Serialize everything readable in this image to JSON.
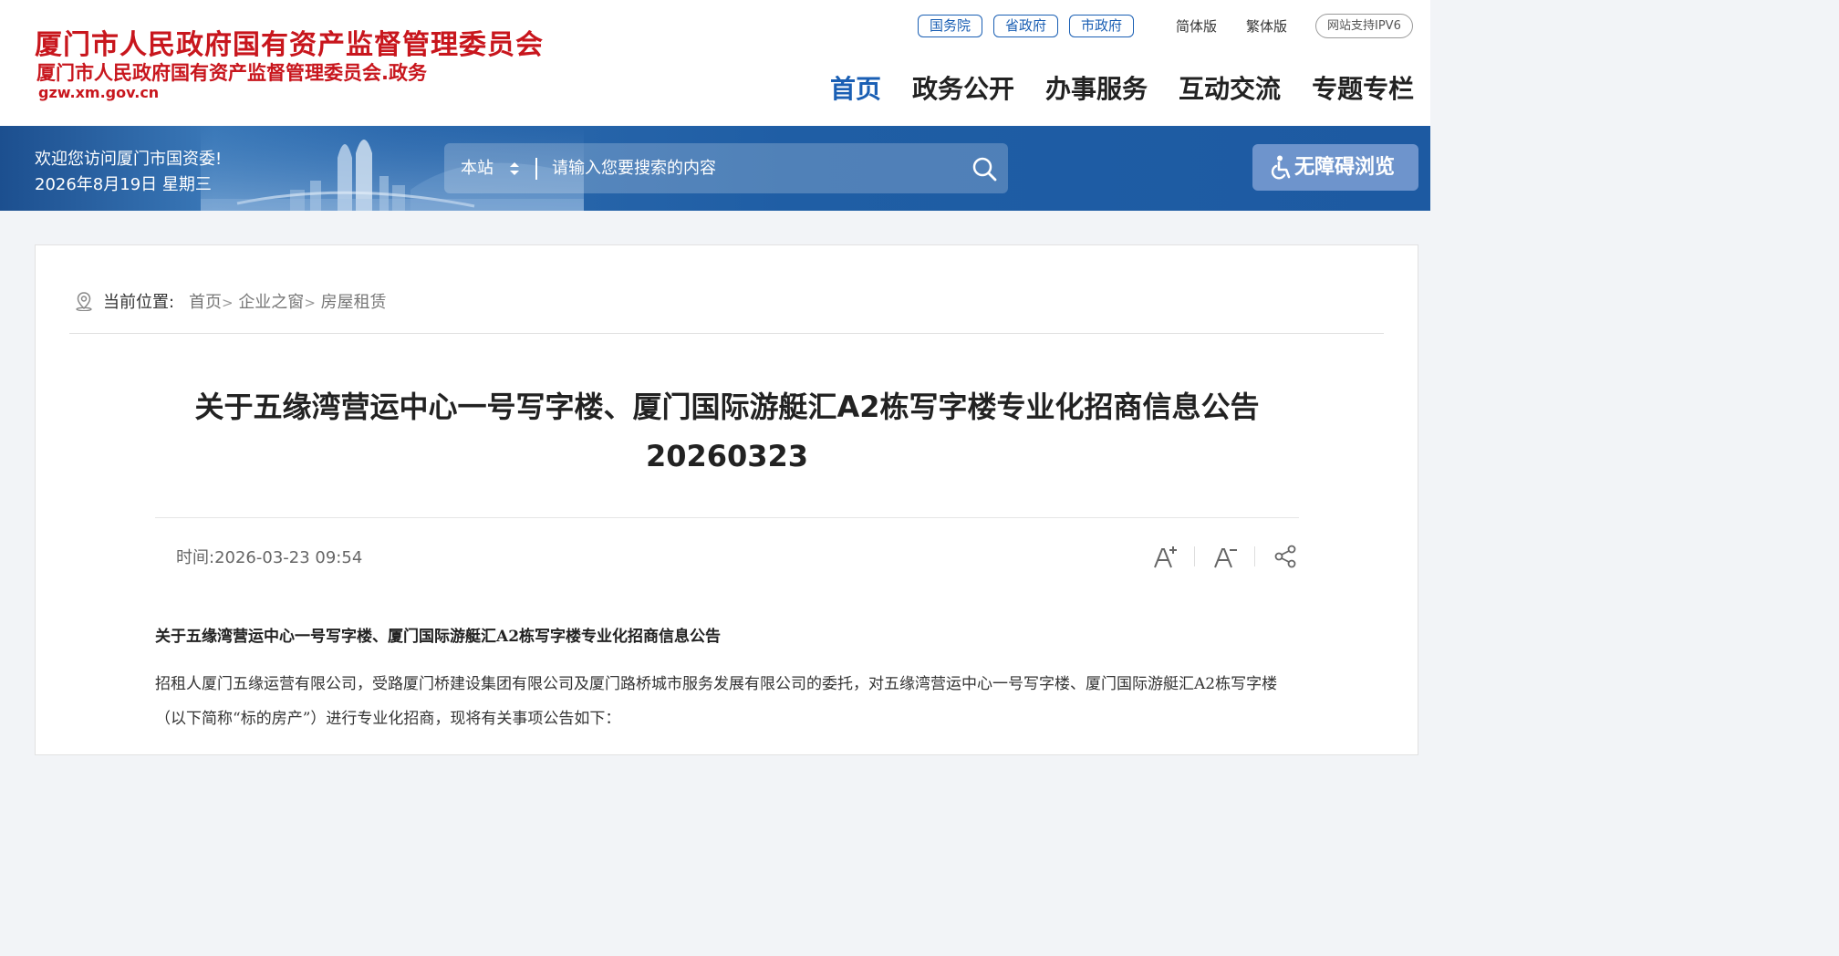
{
  "header": {
    "logo_title": "厦门市人民政府国有资产监督管理委员会",
    "logo_subtitle": "厦门市人民政府国有资产监督管理委员会.政务",
    "logo_domain": "gzw.xm.gov.cn",
    "links": [
      "国务院",
      "省政府",
      "市政府"
    ],
    "lang_simplified": "简体版",
    "lang_traditional": "繁体版",
    "ipv6": "网站支持IPV6",
    "nav": [
      "首页",
      "政务公开",
      "办事服务",
      "互动交流",
      "专题专栏"
    ],
    "active_nav": "首页"
  },
  "banner": {
    "welcome": "欢迎您访问厦门市国资委!",
    "date": "2026年8月19日 星期三",
    "search_scope": "本站",
    "search_placeholder": "请输入您要搜索的内容",
    "accessibility": "无障碍浏览"
  },
  "breadcrumb": {
    "label": "当前位置:",
    "items": [
      "首页",
      "企业之窗",
      "房屋租赁"
    ],
    "separator": ">"
  },
  "article": {
    "title": "关于五缘湾营运中心一号写字楼、厦门国际游艇汇A2栋写字楼专业化招商信息公告20260323",
    "time_label": "时间:",
    "time_value": "2026-03-23 09:54",
    "subheading": "关于五缘湾营运中心一号写字楼、厦门国际游艇汇A2栋写字楼专业化招商信息公告",
    "paragraph": "招租人厦门五缘运营有限公司，受路厦门桥建设集团有限公司及厦门路桥城市服务发展有限公司的委托，对五缘湾营运中心一号写字楼、厦门国际游艇汇A2栋写字楼（以下简称“标的房产”）进行专业化招商，现将有关事项公告如下："
  },
  "tools": [
    "font-increase-icon",
    "font-decrease-icon",
    "share-icon"
  ],
  "colors": {
    "brand_red": "#c8161d",
    "nav_blue": "#1a5fb4",
    "banner_blue": "#1f5ea5"
  }
}
